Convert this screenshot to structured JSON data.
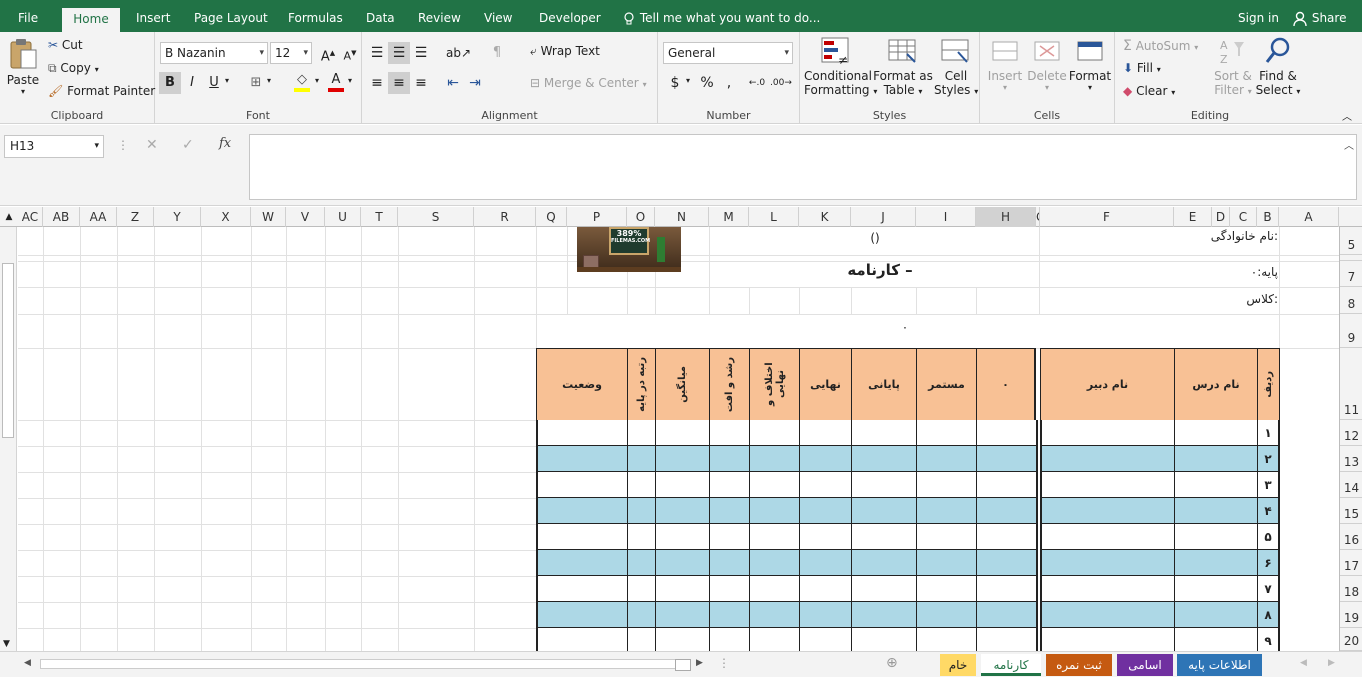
{
  "ribbon_tabs": [
    "File",
    "Home",
    "Insert",
    "Page Layout",
    "Formulas",
    "Data",
    "Review",
    "View",
    "Developer"
  ],
  "tell_me": "Tell me what you want to do...",
  "sign_in": "Sign in",
  "share": "Share",
  "clipboard": {
    "paste": "Paste",
    "cut": "Cut",
    "copy": "Copy",
    "format_painter": "Format Painter",
    "label": "Clipboard"
  },
  "font": {
    "name": "B Nazanin",
    "size": "12",
    "label": "Font"
  },
  "alignment": {
    "wrap_text": "Wrap Text",
    "merge_center": "Merge & Center",
    "label": "Alignment"
  },
  "number": {
    "format": "General",
    "label": "Number",
    "currency": "$",
    "percent": "%",
    "comma": ","
  },
  "styles": {
    "conditional": "Conditional",
    "formatting": "Formatting",
    "format_as": "Format as",
    "table": "Table",
    "cell": "Cell",
    "styles_label": "Styles",
    "label": "Styles"
  },
  "cells": {
    "insert": "Insert",
    "delete": "Delete",
    "format": "Format",
    "label": "Cells"
  },
  "editing": {
    "autosum": "AutoSum",
    "fill": "Fill",
    "clear": "Clear",
    "sort": "Sort &",
    "filter": "Filter",
    "find": "Find &",
    "select": "Select",
    "label": "Editing"
  },
  "name_box": "H13",
  "columns": [
    "AC",
    "AB",
    "AA",
    "Z",
    "Y",
    "X",
    "W",
    "V",
    "U",
    "T",
    "S",
    "R",
    "Q",
    "P",
    "O",
    "N",
    "M",
    "L",
    "K",
    "J",
    "I",
    "H",
    "G",
    "F",
    "E",
    "D",
    "C",
    "B",
    "A"
  ],
  "rows": [
    "5",
    "7",
    "8",
    "9",
    "11",
    "12",
    "13",
    "14",
    "15",
    "16",
    "17",
    "18",
    "19",
    "20"
  ],
  "sheet": {
    "family_name_label": "نام خانوادگی:",
    "family_name_value": "()",
    "grade_label": "پایه:۰",
    "title": "کارنامه –",
    "class_label": "کلاس:",
    "dot": "۰",
    "logo_percent": "389%",
    "logo_site": "FILEMAS.COM",
    "headers": {
      "radif": "ردیف",
      "course": "نام درس",
      "teacher": "نام دبیر",
      "zero": "۰",
      "continuous": "مستمر",
      "final_term": "پایانی",
      "final": "نهایی",
      "diff": "اختلاف و نهایی",
      "growth": "رشد و افت",
      "average": "میانگین",
      "rank": "رتبه در پایه",
      "status": "وضعیت"
    },
    "row_numbers": [
      "۱",
      "۲",
      "۳",
      "۴",
      "۵",
      "۶",
      "۷",
      "۸",
      "۹"
    ]
  },
  "sheet_tabs": [
    {
      "label": "اطلاعات پایه",
      "color": "#2e75b6"
    },
    {
      "label": "اسامی",
      "color": "#7030a0"
    },
    {
      "label": "ثبت نمره",
      "color": "#c55a11"
    },
    {
      "label": "کارنامه",
      "color": "#217346"
    },
    {
      "label": "خام",
      "color": "#ffd966"
    }
  ],
  "colors": {
    "header_fill": "#f8c195",
    "band_fill": "#add8e6",
    "excel_green": "#217346"
  }
}
